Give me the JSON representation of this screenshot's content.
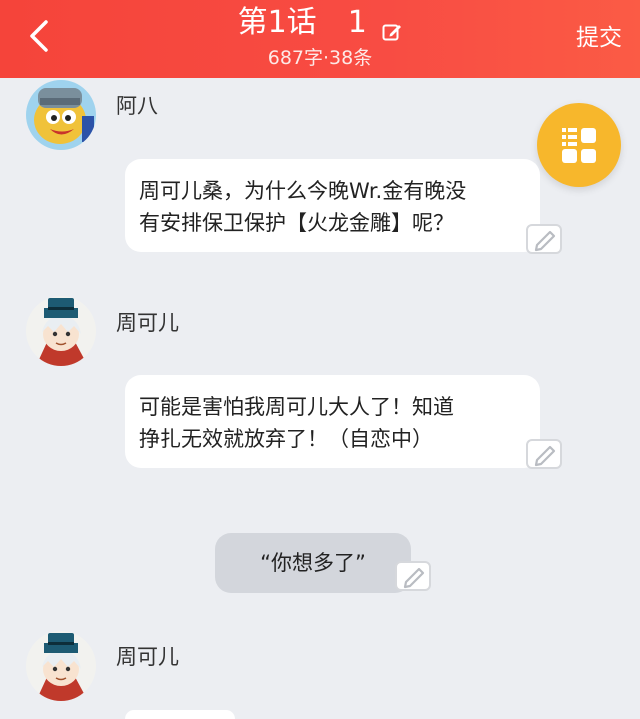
{
  "header": {
    "title": "第1话",
    "episode_number": "1",
    "stats": "687字·38条",
    "submit_label": "提交",
    "background_color": "#f5443a"
  },
  "fab": {
    "icon": "grid-menu-icon",
    "color": "#f7b72c"
  },
  "messages": [
    {
      "speaker": "阿八",
      "lines": [
        "周可儿桑，为什么今晚Wr.金有晚没",
        "有安排保卫保护【火龙金雕】呢？"
      ]
    },
    {
      "speaker": "周可儿",
      "lines": [
        "可能是害怕我周可儿大人了！知道",
        "挣扎无效就放弃了！（自恋中）"
      ]
    },
    {
      "narration": "“你想多了”"
    },
    {
      "speaker": "周可儿"
    }
  ]
}
